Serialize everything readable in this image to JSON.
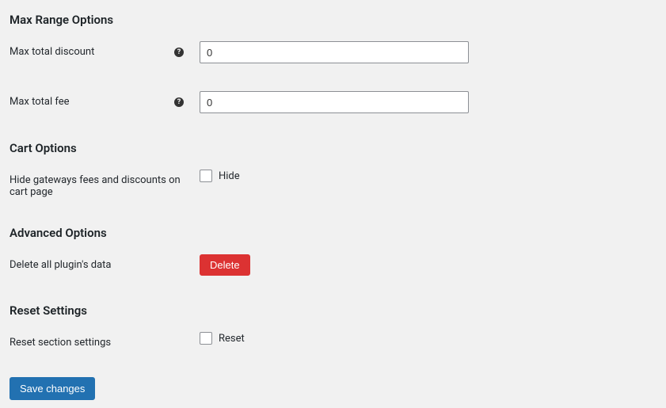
{
  "sections": {
    "max_range": {
      "heading": "Max Range Options",
      "max_discount_label": "Max total discount",
      "max_discount_value": "0",
      "max_fee_label": "Max total fee",
      "max_fee_value": "0"
    },
    "cart": {
      "heading": "Cart Options",
      "hide_label": "Hide gateways fees and discounts on cart page",
      "hide_checkbox_label": "Hide"
    },
    "advanced": {
      "heading": "Advanced Options",
      "delete_label": "Delete all plugin's data",
      "delete_button": "Delete"
    },
    "reset": {
      "heading": "Reset Settings",
      "reset_label": "Reset section settings",
      "reset_checkbox_label": "Reset"
    }
  },
  "submit": {
    "save_label": "Save changes"
  },
  "icons": {
    "help": "?"
  }
}
